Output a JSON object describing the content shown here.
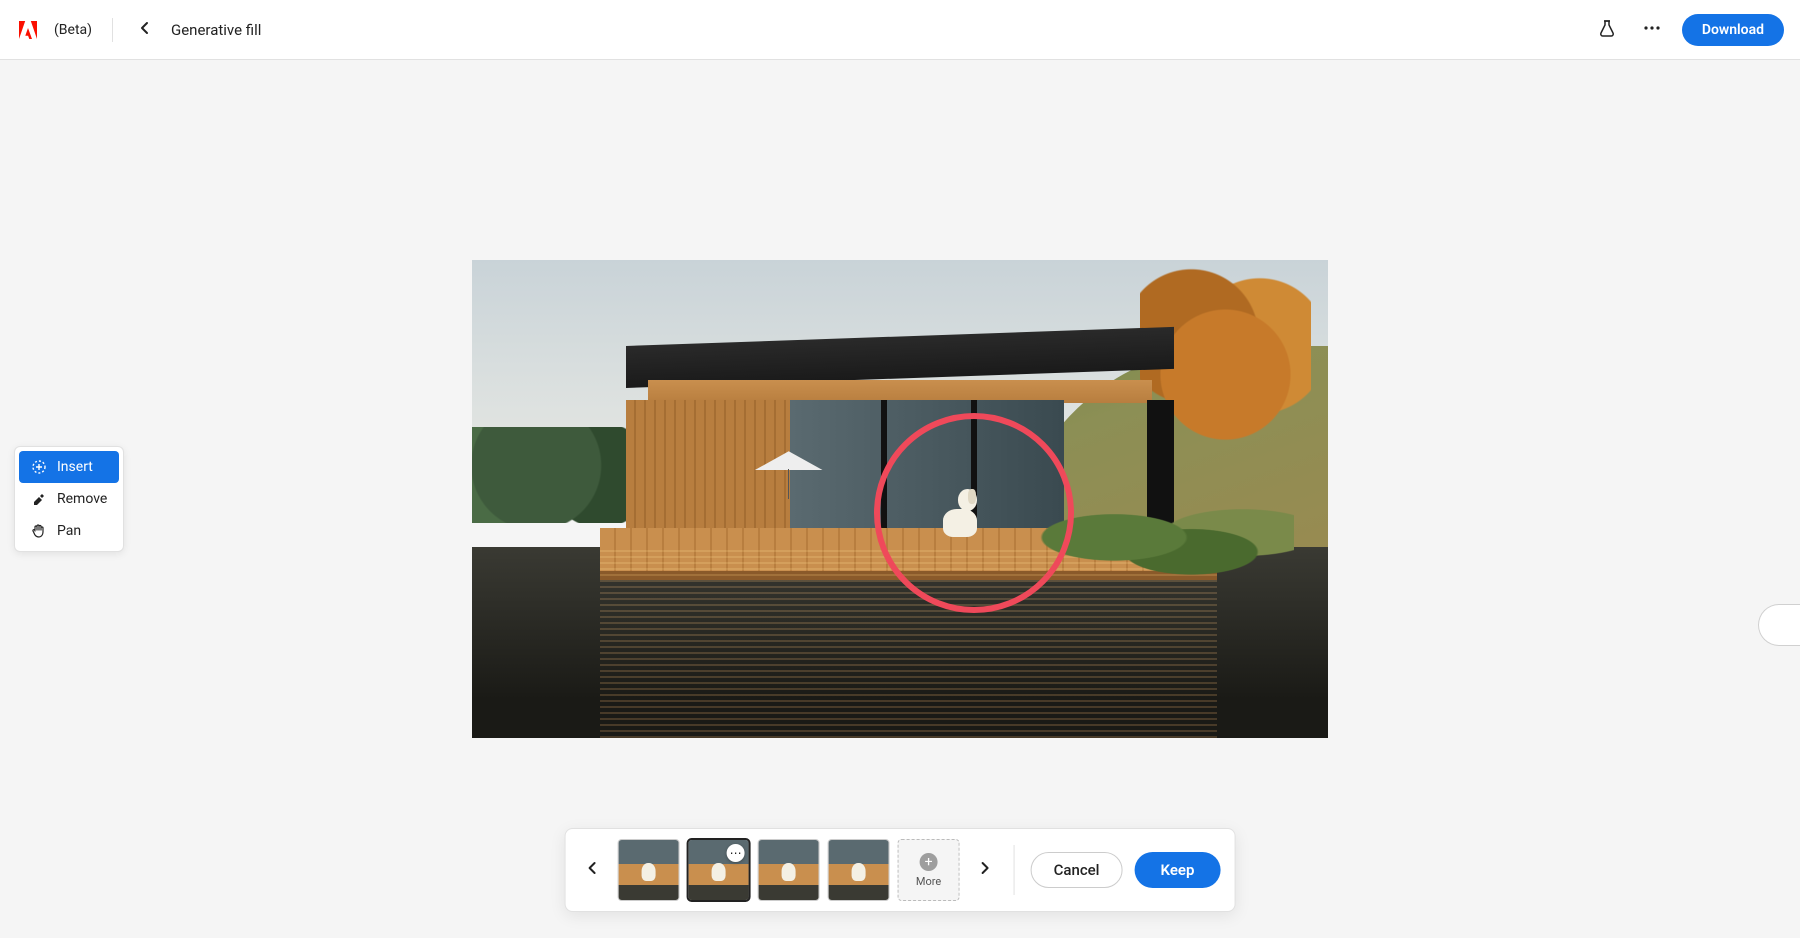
{
  "header": {
    "beta_label": "(Beta)",
    "breadcrumb": "Generative fill",
    "download_label": "Download"
  },
  "tools": {
    "insert": "Insert",
    "remove": "Remove",
    "pan": "Pan",
    "active": "insert"
  },
  "variations": {
    "count": 4,
    "selected_index": 1,
    "more_label": "More"
  },
  "actions": {
    "cancel": "Cancel",
    "keep": "Keep"
  }
}
